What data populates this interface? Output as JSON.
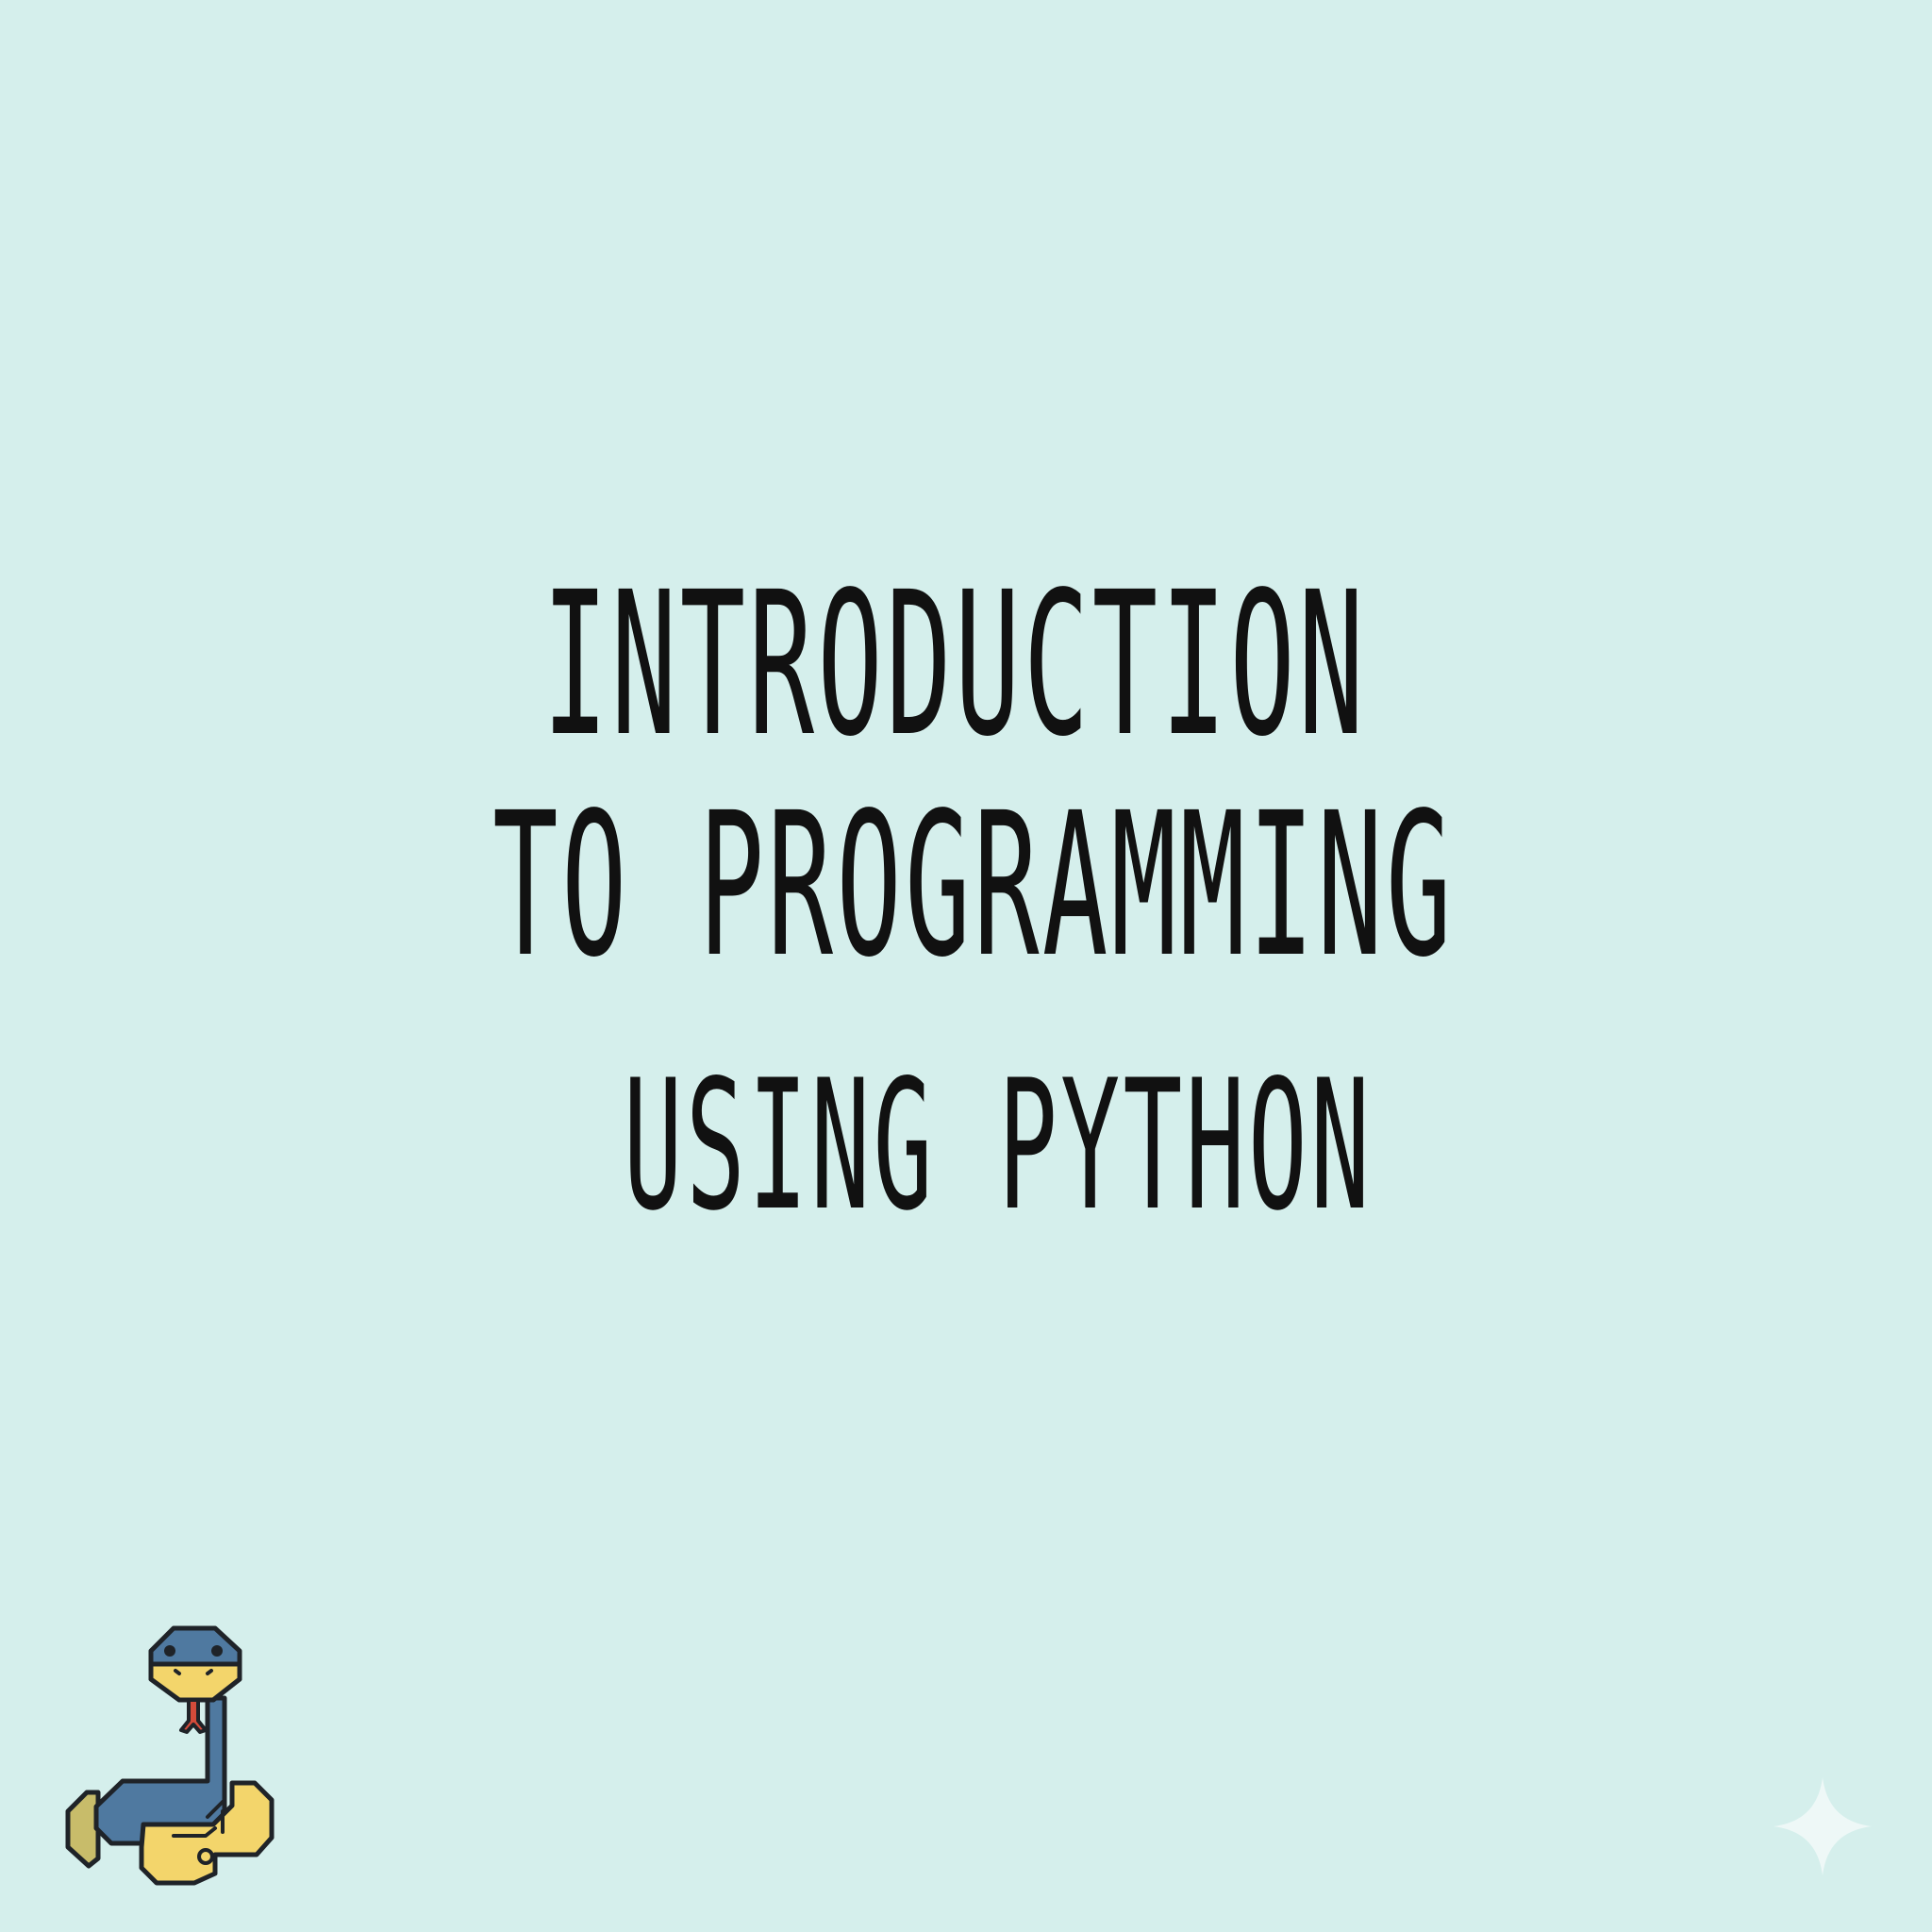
{
  "title": {
    "line1": "INTRODUCTION",
    "line2": "TO PROGRAMMING",
    "line3": "USING PYTHON"
  },
  "graphics": {
    "logo_icon": "python-snake-icon",
    "sparkle_icon": "sparkle-watermark-icon",
    "colors": {
      "background": "#d5efec",
      "text": "#111111",
      "snake_blue": "#4f79a0",
      "snake_yellow": "#f3d56b",
      "snake_olive": "#c8bc6a",
      "tongue": "#d44b3a",
      "outline": "#1f2328",
      "sparkle": "#eef8f7"
    }
  }
}
